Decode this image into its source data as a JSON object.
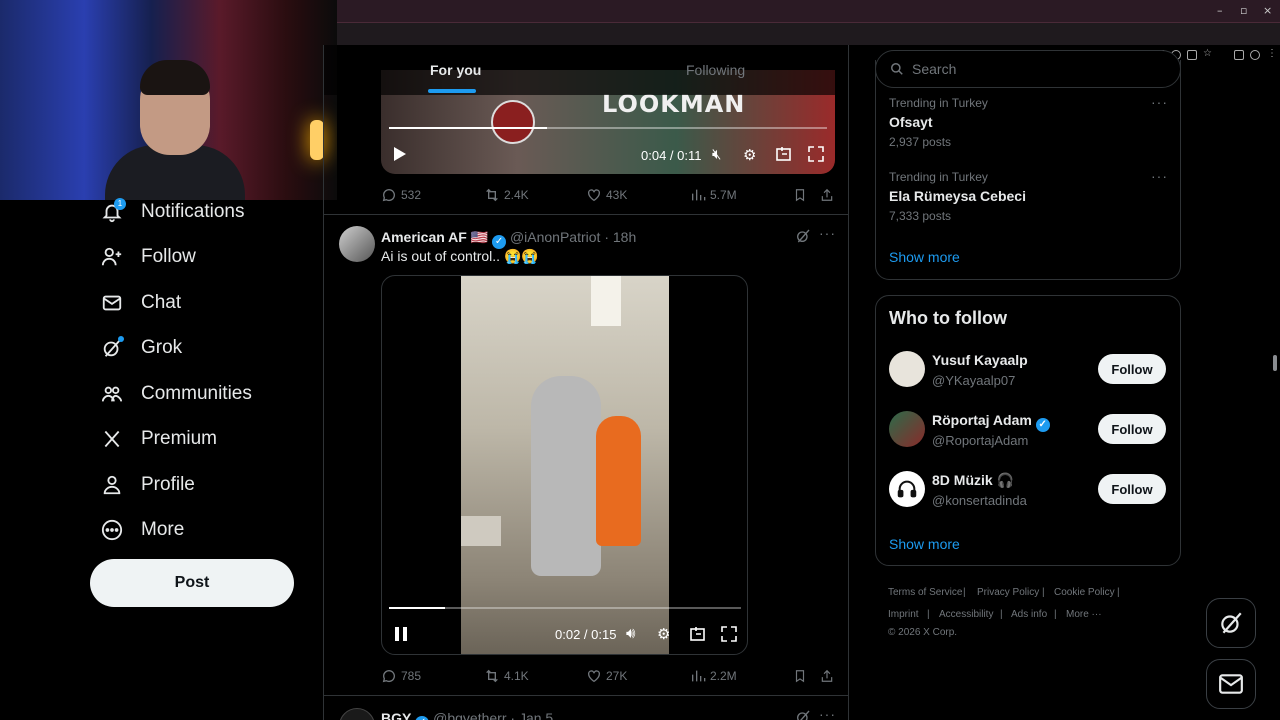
{
  "window": {
    "minimize": "–",
    "restore": "▫",
    "close": "×"
  },
  "nav": {
    "items": [
      {
        "label": "Notifications",
        "icon": "bell-icon",
        "badge": "1"
      },
      {
        "label": "Follow",
        "icon": "person-add-icon"
      },
      {
        "label": "Chat",
        "icon": "mail-icon"
      },
      {
        "label": "Grok",
        "icon": "grok-icon"
      },
      {
        "label": "Communities",
        "icon": "communities-icon"
      },
      {
        "label": "Premium",
        "icon": "x-logo-icon"
      },
      {
        "label": "Profile",
        "icon": "person-icon"
      },
      {
        "label": "More",
        "icon": "more-circle-icon"
      }
    ],
    "post_label": "Post"
  },
  "tabs": {
    "for_you": "For you",
    "following": "Following"
  },
  "tweet1": {
    "video_text": "LOOKMAN",
    "time": "0:04 / 0:11",
    "replies": "532",
    "reposts": "2.4K",
    "likes": "43K",
    "views": "5.7M"
  },
  "tweet2": {
    "name": "American AF",
    "flag": "🇺🇸",
    "handle": "@iAnonPatriot",
    "sep": "·",
    "time": "18h",
    "text": "Ai is out of control.. 😭😭",
    "video_time": "0:02 / 0:15",
    "progress": 0.16,
    "replies": "785",
    "reposts": "4.1K",
    "likes": "27K",
    "views": "2.2M"
  },
  "tweet3": {
    "name": "BGY",
    "handle": "@bgyetherr",
    "sep": "·",
    "time": "Jan 5"
  },
  "search": {
    "placeholder": "Search"
  },
  "trends": {
    "items": [
      {
        "context": "Trending in Turkey",
        "name": "Ofsayt",
        "count": "2,937 posts"
      },
      {
        "context": "Trending in Turkey",
        "name": "Ela Rümeysa Cebeci",
        "count": "7,333 posts"
      }
    ],
    "show_more": "Show more"
  },
  "who_to_follow": {
    "title": "Who to follow",
    "users": [
      {
        "name": "Yusuf Kayaalp",
        "handle": "@YKayaalp07",
        "button": "Follow"
      },
      {
        "name": "Röportaj Adam",
        "handle": "@RoportajAdam",
        "button": "Follow"
      },
      {
        "name": "8D Müzik 🎧",
        "handle": "@konsertadinda",
        "button": "Follow"
      }
    ],
    "show_more": "Show more"
  },
  "footer": {
    "links": [
      "Terms of Service",
      "Privacy Policy",
      "Cookie Policy",
      "Imprint",
      "Accessibility",
      "Ads info",
      "More ···"
    ],
    "separator": "|",
    "copyright": "© 2026 X Corp."
  },
  "colors": {
    "accent": "#1d9bf0",
    "background": "#000000",
    "border": "#2f3336",
    "muted": "#71767b"
  }
}
